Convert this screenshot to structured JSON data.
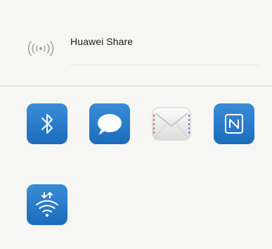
{
  "share_row": {
    "icon": "signal-broadcast-icon",
    "label": "Huawei Share"
  },
  "share_targets": [
    {
      "id": "bluetooth",
      "icon": "bluetooth-icon"
    },
    {
      "id": "messaging",
      "icon": "message-bubble-icon"
    },
    {
      "id": "email",
      "icon": "envelope-icon"
    },
    {
      "id": "nfc",
      "icon": "nfc-icon"
    },
    {
      "id": "wifi-direct",
      "icon": "wifi-direct-icon"
    }
  ],
  "colors": {
    "tile_blue_top": "#3a8cd6",
    "tile_blue_bottom": "#1c6cbd",
    "background": "#f6f6f4",
    "text": "#1b1b1b"
  }
}
